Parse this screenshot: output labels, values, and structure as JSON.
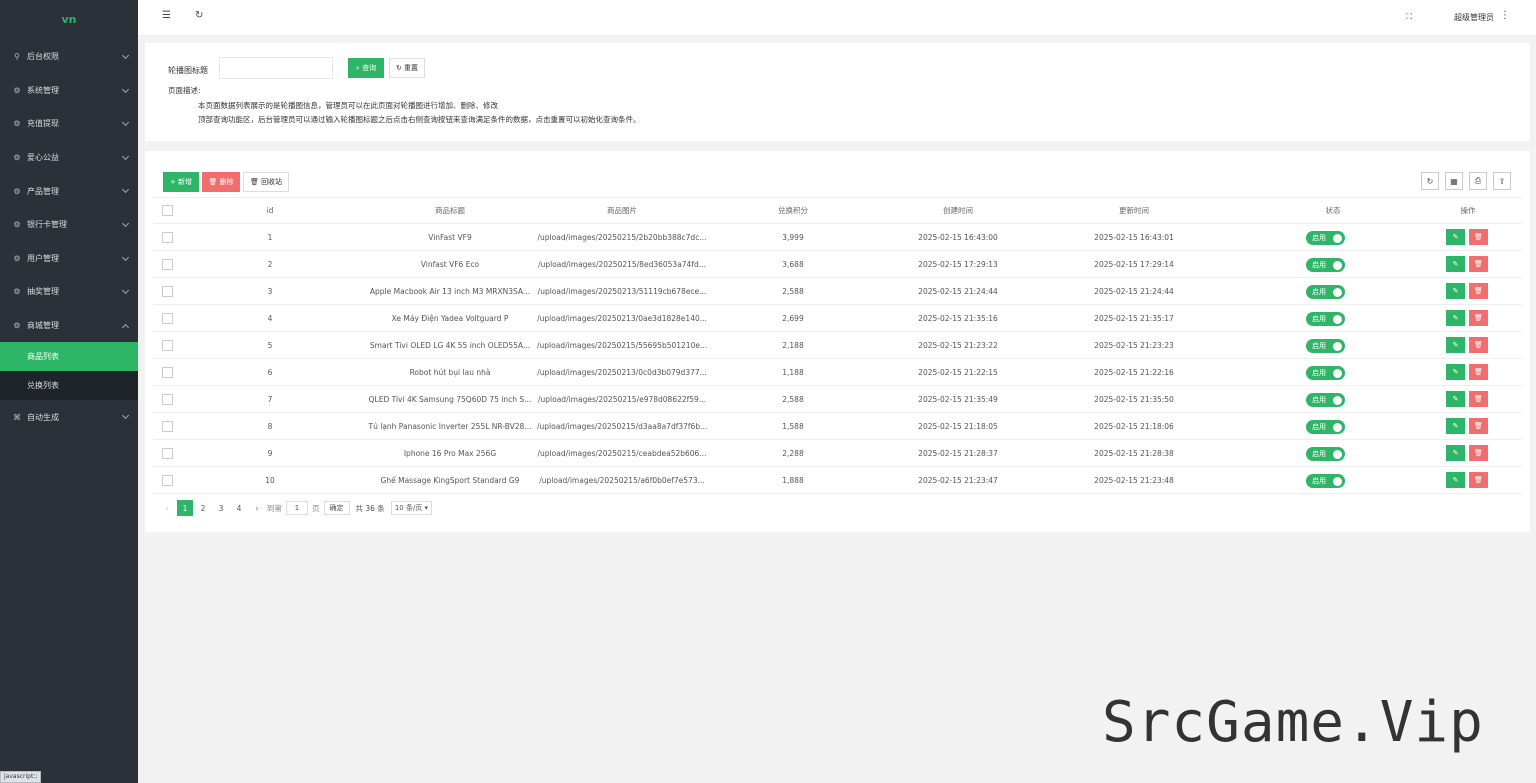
{
  "sidebar": {
    "logo": "vn",
    "items": [
      {
        "label": "后台权限",
        "icon": "user-icon"
      },
      {
        "label": "系统管理",
        "icon": "gear-icon"
      },
      {
        "label": "充值提现",
        "icon": "gear-icon"
      },
      {
        "label": "爱心公益",
        "icon": "gear-icon"
      },
      {
        "label": "产品管理",
        "icon": "gear-icon"
      },
      {
        "label": "银行卡管理",
        "icon": "gear-icon"
      },
      {
        "label": "用户管理",
        "icon": "gear-icon"
      },
      {
        "label": "抽奖管理",
        "icon": "gear-icon"
      },
      {
        "label": "商城管理",
        "icon": "gear-icon"
      }
    ],
    "sub_items": [
      {
        "label": "商品列表",
        "active": true
      },
      {
        "label": "兑换列表",
        "active": false
      }
    ],
    "last_item": {
      "label": "自动生成",
      "icon": "code-icon"
    }
  },
  "header": {
    "user": "超级管理员"
  },
  "search": {
    "label": "轮播图标题",
    "value": "",
    "query_label": "查询",
    "reset_label": "重置"
  },
  "description": {
    "title": "页面描述:",
    "line1": "本页面数据列表展示的是轮播图信息，管理员可以在此页面对轮播图进行增加、删除、修改",
    "line2": "顶部查询功能区，后台管理员可以通过输入轮播图标题之后点击右侧查询按钮来查询满足条件的数据，点击重置可以初始化查询条件。"
  },
  "toolbar": {
    "add_label": "新增",
    "delete_label": "删除",
    "recycle_label": "回收站"
  },
  "table": {
    "columns": [
      "id",
      "商品标题",
      "商品图片",
      "兑换积分",
      "创建时间",
      "更新时间",
      "状态",
      "操作"
    ],
    "rows": [
      {
        "id": "1",
        "title": "VinFast VF9",
        "image": "/upload/images/20250215/2b20bb388c7dc...",
        "points": "3,999",
        "created": "2025-02-15 16:43:00",
        "updated": "2025-02-15 16:43:01",
        "status": "启用"
      },
      {
        "id": "2",
        "title": "Vinfast VF6 Eco",
        "image": "/upload/images/20250215/8ed36053a74fd...",
        "points": "3,688",
        "created": "2025-02-15 17:29:13",
        "updated": "2025-02-15 17:29:14",
        "status": "启用"
      },
      {
        "id": "3",
        "title": "Apple Macbook Air 13 inch M3 MRXN3SA...",
        "image": "/upload/images/20250213/51119cb678ece...",
        "points": "2,588",
        "created": "2025-02-15 21:24:44",
        "updated": "2025-02-15 21:24:44",
        "status": "启用"
      },
      {
        "id": "4",
        "title": "Xe Máy Điện Yadea Voltguard P",
        "image": "/upload/images/20250213/0ae3d1828e140...",
        "points": "2,699",
        "created": "2025-02-15 21:35:16",
        "updated": "2025-02-15 21:35:17",
        "status": "启用"
      },
      {
        "id": "5",
        "title": "Smart Tivi OLED LG 4K 55 inch OLED55A...",
        "image": "/upload/images/20250215/55695b501210e...",
        "points": "2,188",
        "created": "2025-02-15 21:23:22",
        "updated": "2025-02-15 21:23:23",
        "status": "启用"
      },
      {
        "id": "6",
        "title": "Robot hút bụi lau nhà",
        "image": "/upload/images/20250213/0c0d3b079d377...",
        "points": "1,188",
        "created": "2025-02-15 21:22:15",
        "updated": "2025-02-15 21:22:16",
        "status": "启用"
      },
      {
        "id": "7",
        "title": "QLED Tivi 4K Samsung 75Q60D 75 inch S...",
        "image": "/upload/images/20250215/e978d08622f59...",
        "points": "2,588",
        "created": "2025-02-15 21:35:49",
        "updated": "2025-02-15 21:35:50",
        "status": "启用"
      },
      {
        "id": "8",
        "title": "Tủ lạnh Panasonic Inverter 255L NR-BV28...",
        "image": "/upload/images/20250215/d3aa8a7df37f6b...",
        "points": "1,588",
        "created": "2025-02-15 21:18:05",
        "updated": "2025-02-15 21:18:06",
        "status": "启用"
      },
      {
        "id": "9",
        "title": "Iphone 16 Pro Max 256G",
        "image": "/upload/images/20250215/ceabdea52b606...",
        "points": "2,288",
        "created": "2025-02-15 21:28:37",
        "updated": "2025-02-15 21:28:38",
        "status": "启用"
      },
      {
        "id": "10",
        "title": "Ghế Massage KingSport Standard G9",
        "image": "/upload/images/20250215/a6f0b0ef7e573...",
        "points": "1,888",
        "created": "2025-02-15 21:23:47",
        "updated": "2025-02-15 21:23:48",
        "status": "启用"
      }
    ]
  },
  "pager": {
    "pages": [
      "1",
      "2",
      "3",
      "4"
    ],
    "goto_label": "到第",
    "goto_value": "1",
    "page_unit": "页",
    "confirm_label": "确定",
    "total_label": "共 36 条",
    "per_page": "10 条/页"
  },
  "watermark": "SrcGame.Vip",
  "statusbar": "javascript:;",
  "colors": {
    "primary": "#2fb567",
    "danger": "#f16e6e",
    "sidebar": "#2b3139"
  }
}
